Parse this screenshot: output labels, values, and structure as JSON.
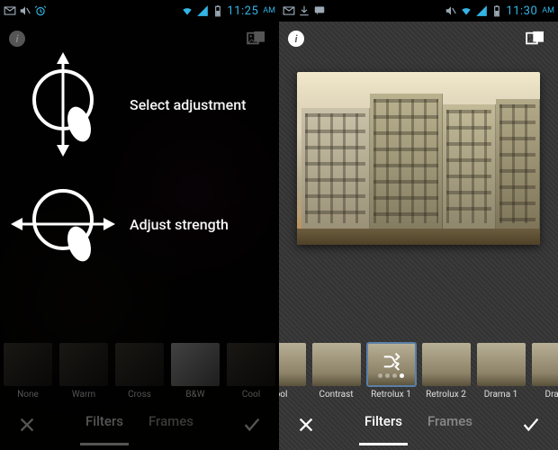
{
  "left_screen": {
    "statusbar": {
      "notif_icons": [
        "envelope-icon",
        "mute-icon",
        "alarm-icon"
      ],
      "sys_icons": [
        "wifi-icon",
        "signal-icon",
        "battery-icon"
      ],
      "time": "11:25",
      "ampm": "AM"
    },
    "info_label": "i",
    "gesture1_label": "Select adjustment",
    "gesture2_label": "Adjust strength",
    "filters": [
      {
        "label": "None"
      },
      {
        "label": "Warm"
      },
      {
        "label": "Cross"
      },
      {
        "label": "B&W"
      },
      {
        "label": "Cool"
      }
    ],
    "tabs": {
      "filters": "Filters",
      "frames": "Frames",
      "active": "filters"
    },
    "actions": {
      "cancel": "Cancel",
      "apply": "Apply"
    }
  },
  "right_screen": {
    "statusbar": {
      "notif_icons": [
        "envelope-icon",
        "download-icon",
        "chat-icon"
      ],
      "sys_icons": [
        "mute-icon",
        "wifi-icon",
        "signal-icon",
        "battery-icon"
      ],
      "time": "11:30",
      "ampm": "AM"
    },
    "info_label": "i",
    "filters": [
      {
        "label": "ool"
      },
      {
        "label": "Contrast"
      },
      {
        "label": "Retrolux 1",
        "selected": true,
        "page_index": 3,
        "page_count": 4
      },
      {
        "label": "Retrolux 2"
      },
      {
        "label": "Drama 1"
      },
      {
        "label": "Dram"
      }
    ],
    "tabs": {
      "filters": "Filters",
      "frames": "Frames",
      "active": "filters"
    },
    "actions": {
      "cancel": "Cancel",
      "apply": "Apply"
    }
  }
}
